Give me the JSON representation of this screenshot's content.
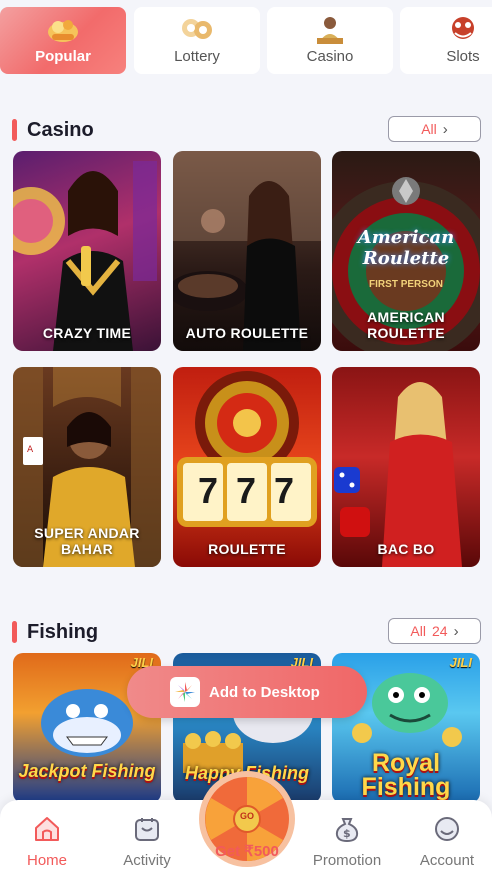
{
  "tabs": [
    {
      "label": "Popular",
      "icon": "popular-icon",
      "active": true
    },
    {
      "label": "Lottery",
      "icon": "lottery-icon"
    },
    {
      "label": "Casino",
      "icon": "casino-icon"
    },
    {
      "label": "Slots",
      "icon": "slots-icon"
    }
  ],
  "casino": {
    "title": "Casino",
    "all_label": "All",
    "games": [
      {
        "label": "CRAZY TIME"
      },
      {
        "label": "AUTO ROULETTE"
      },
      {
        "label": "AMERICAN ROULETTE",
        "art_text": "American Roulette",
        "art_sub": "FIRST PERSON"
      },
      {
        "label": "SUPER ANDAR BAHAR"
      },
      {
        "label": "ROULETTE",
        "art_reels": "777"
      },
      {
        "label": "BAC BO"
      }
    ]
  },
  "fishing": {
    "title": "Fishing",
    "all_label": "All",
    "count": "24",
    "games": [
      {
        "brand": "JILI",
        "title": "Jackpot Fishing"
      },
      {
        "brand": "JILI",
        "title": "Happy Fishing"
      },
      {
        "brand": "JILI",
        "title": "Royal Fishing"
      }
    ]
  },
  "add_to_desktop": {
    "label": "Add to Desktop"
  },
  "wheel": {
    "center": "GO",
    "label": "Get ₹500"
  },
  "bottom_nav": [
    {
      "label": "Home",
      "icon": "home-icon",
      "active": true
    },
    {
      "label": "Activity",
      "icon": "activity-icon"
    },
    {
      "label": "Promotion",
      "icon": "promotion-icon"
    },
    {
      "label": "Account",
      "icon": "account-icon"
    }
  ],
  "colors": {
    "accent": "#f25a5a",
    "background": "#f4f5fa"
  }
}
